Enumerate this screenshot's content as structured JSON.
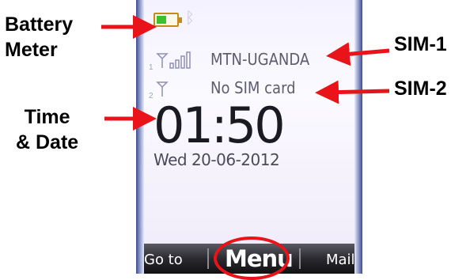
{
  "annotations": {
    "battery_line1": "Battery",
    "battery_line2": "Meter",
    "time_line1": "Time",
    "time_line2": "& Date",
    "sim1": "SIM-1",
    "sim2": "SIM-2"
  },
  "status": {
    "battery_level": 0.5,
    "sim1_number": "1",
    "sim2_number": "2"
  },
  "operators": {
    "sim1": "MTN-UGANDA",
    "sim2": "No SIM card"
  },
  "clock": {
    "time": "01:50",
    "date": "Wed 20-06-2012"
  },
  "softkeys": {
    "left": "Go to",
    "middle": "Menu",
    "right": "Mail"
  },
  "colors": {
    "arrow": "#e8141a",
    "battery_fill": "#3fbf2a"
  }
}
